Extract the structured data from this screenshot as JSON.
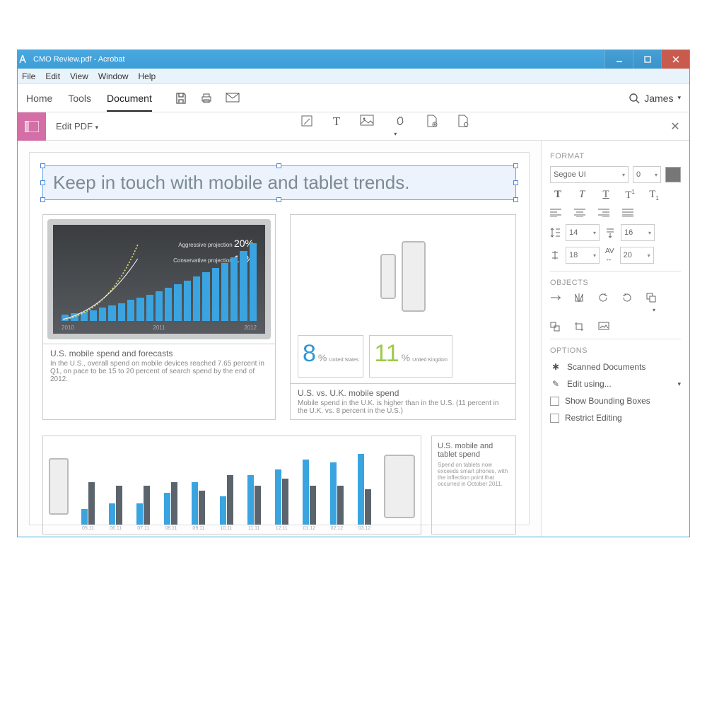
{
  "titlebar": {
    "title": "CMO Review.pdf - Acrobat"
  },
  "menubar": [
    "File",
    "Edit",
    "View",
    "Window",
    "Help"
  ],
  "topbar": {
    "tabs": [
      "Home",
      "Tools",
      "Document"
    ],
    "active": 2,
    "user": "James"
  },
  "toolbar2": {
    "editpdf": "Edit PDF"
  },
  "doc": {
    "headline": "Keep in touch with mobile and tablet trends.",
    "chart1": {
      "proj1_label": "Aggressive projection",
      "proj1_val": "20%",
      "proj2_label": "Conservative projection",
      "proj2_val": "16%",
      "years": [
        "2010",
        "2011",
        "2012"
      ],
      "caption_title": "U.S. mobile spend and forecasts",
      "caption_body": "In the U.S., overall spend on mobile devices reached 7.65 percent in Q1, on pace to be 15 to 20 percent of search spend by the end of 2012."
    },
    "chart2": {
      "us_val": "8",
      "us_label": "United States",
      "uk_val": "11",
      "uk_label": "United Kingdom",
      "caption_title": "U.S. vs. U.K. mobile spend",
      "caption_body": "Mobile spend in the U.K. is higher than in the U.S. (11 percent in the U.K. vs. 8 percent in the U.S.)"
    },
    "chart3": {
      "months": [
        "05.11",
        "06.11",
        "07.11",
        "08.11",
        "09.11",
        "10.11",
        "11.11",
        "12.11",
        "01.12",
        "02.12",
        "03.12"
      ],
      "side_title": "U.S. mobile and tablet spend",
      "side_body": "Spend on tablets now exceeds smart phones, with the inflection point that occurred in October 2011."
    }
  },
  "format": {
    "sect": "FORMAT",
    "font": "Segoe UI",
    "size": "0",
    "num1": "14",
    "num2": "16",
    "num3": "18",
    "num4": "20"
  },
  "objects": {
    "sect": "OBJECTS"
  },
  "options": {
    "sect": "OPTIONS",
    "scanned": "Scanned Documents",
    "editusing": "Edit using...",
    "bounding": "Show Bounding Boxes",
    "restrict": "Restrict Editing"
  },
  "chart_data": [
    {
      "type": "bar",
      "title": "U.S. mobile spend and forecasts",
      "categories_axis": [
        "2010",
        "2011",
        "2012"
      ],
      "values_pct_of_max": [
        8,
        10,
        12,
        14,
        17,
        20,
        23,
        27,
        30,
        34,
        38,
        43,
        47,
        52,
        57,
        63,
        68,
        75,
        82,
        90,
        100
      ],
      "annotations": [
        {
          "label": "Aggressive projection",
          "value": "20%"
        },
        {
          "label": "Conservative projection",
          "value": "16%"
        }
      ]
    },
    {
      "type": "table",
      "title": "U.S. vs. U.K. mobile spend",
      "series": [
        {
          "name": "United States",
          "value": 8,
          "unit": "%"
        },
        {
          "name": "United Kingdom",
          "value": 11,
          "unit": "%"
        }
      ]
    },
    {
      "type": "bar",
      "title": "U.S. mobile and tablet spend",
      "categories": [
        "05.11",
        "06.11",
        "07.11",
        "08.11",
        "09.11",
        "10.11",
        "11.11",
        "12.11",
        "01.12",
        "02.12",
        "03.12"
      ],
      "series": [
        {
          "name": "tablet",
          "values_pct_of_max": [
            22,
            30,
            30,
            45,
            60,
            40,
            70,
            78,
            92,
            88,
            100
          ]
        },
        {
          "name": "phone",
          "values_pct_of_max": [
            60,
            55,
            55,
            60,
            48,
            70,
            55,
            65,
            55,
            55,
            50
          ]
        }
      ]
    }
  ]
}
